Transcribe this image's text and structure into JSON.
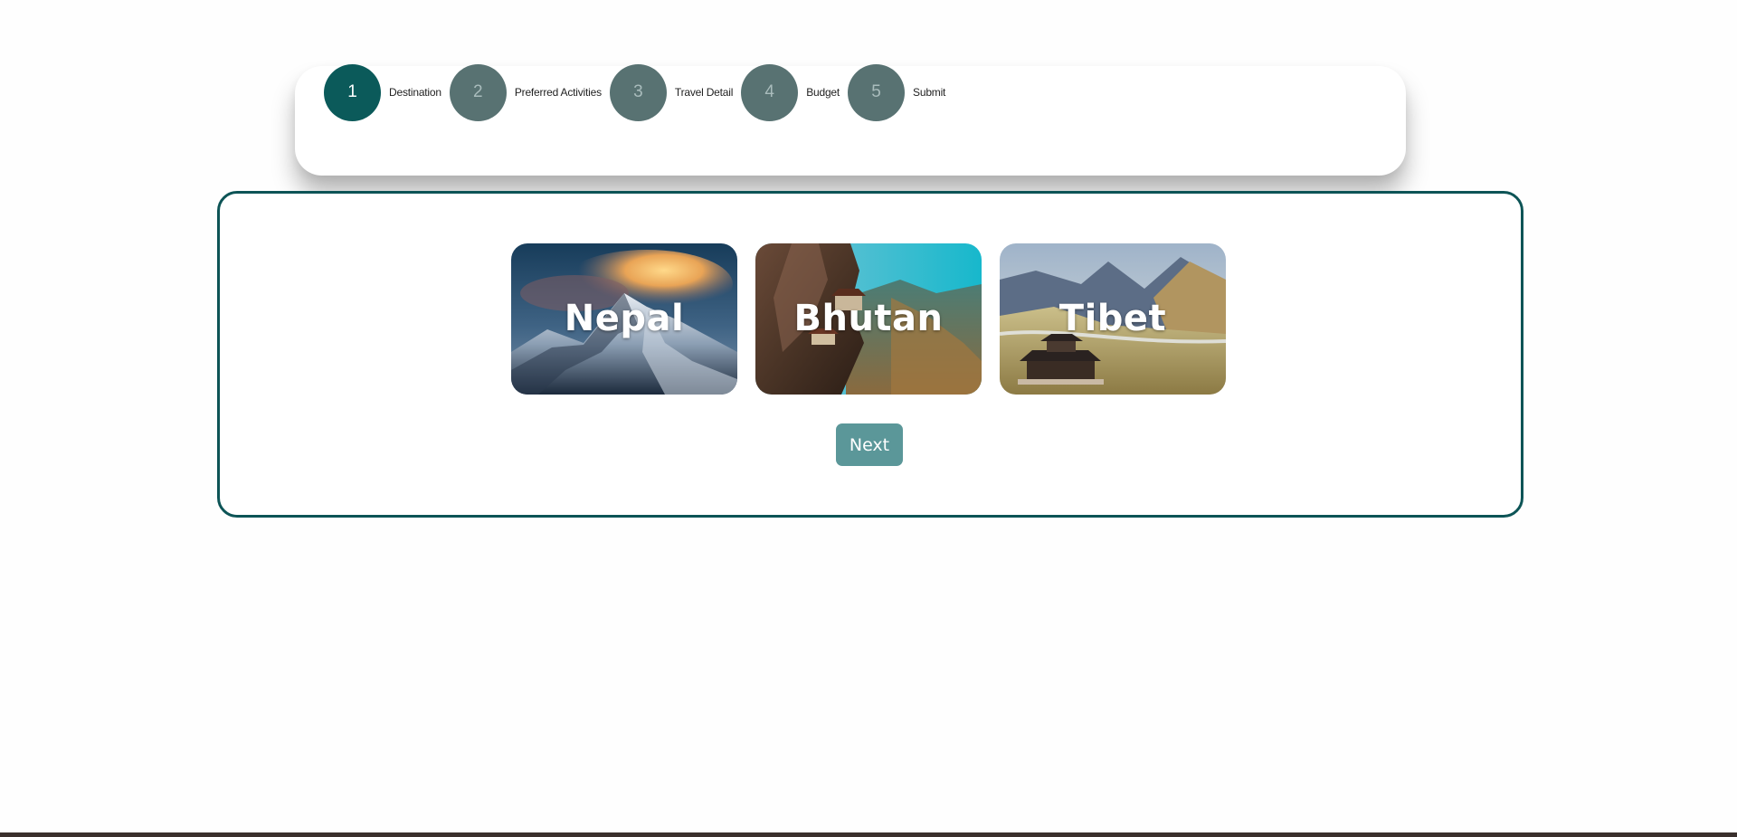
{
  "stepper": {
    "steps": [
      {
        "number": "1",
        "label": "Destination",
        "active": true
      },
      {
        "number": "2",
        "label": "Preferred Activities",
        "active": false
      },
      {
        "number": "3",
        "label": "Travel Detail",
        "active": false
      },
      {
        "number": "4",
        "label": "Budget",
        "active": false
      },
      {
        "number": "5",
        "label": "Submit",
        "active": false
      }
    ]
  },
  "destinations": {
    "cards": [
      {
        "name": "Nepal",
        "image": "mountain-peak-sunset-image"
      },
      {
        "name": "Bhutan",
        "image": "cliffside-monastery-image"
      },
      {
        "name": "Tibet",
        "image": "valley-temple-image"
      }
    ]
  },
  "actions": {
    "next_label": "Next"
  },
  "colors": {
    "active_step": "#0b5a5a",
    "inactive_step": "#587272",
    "panel_border": "#0d5456",
    "next_button": "#5b9799"
  }
}
